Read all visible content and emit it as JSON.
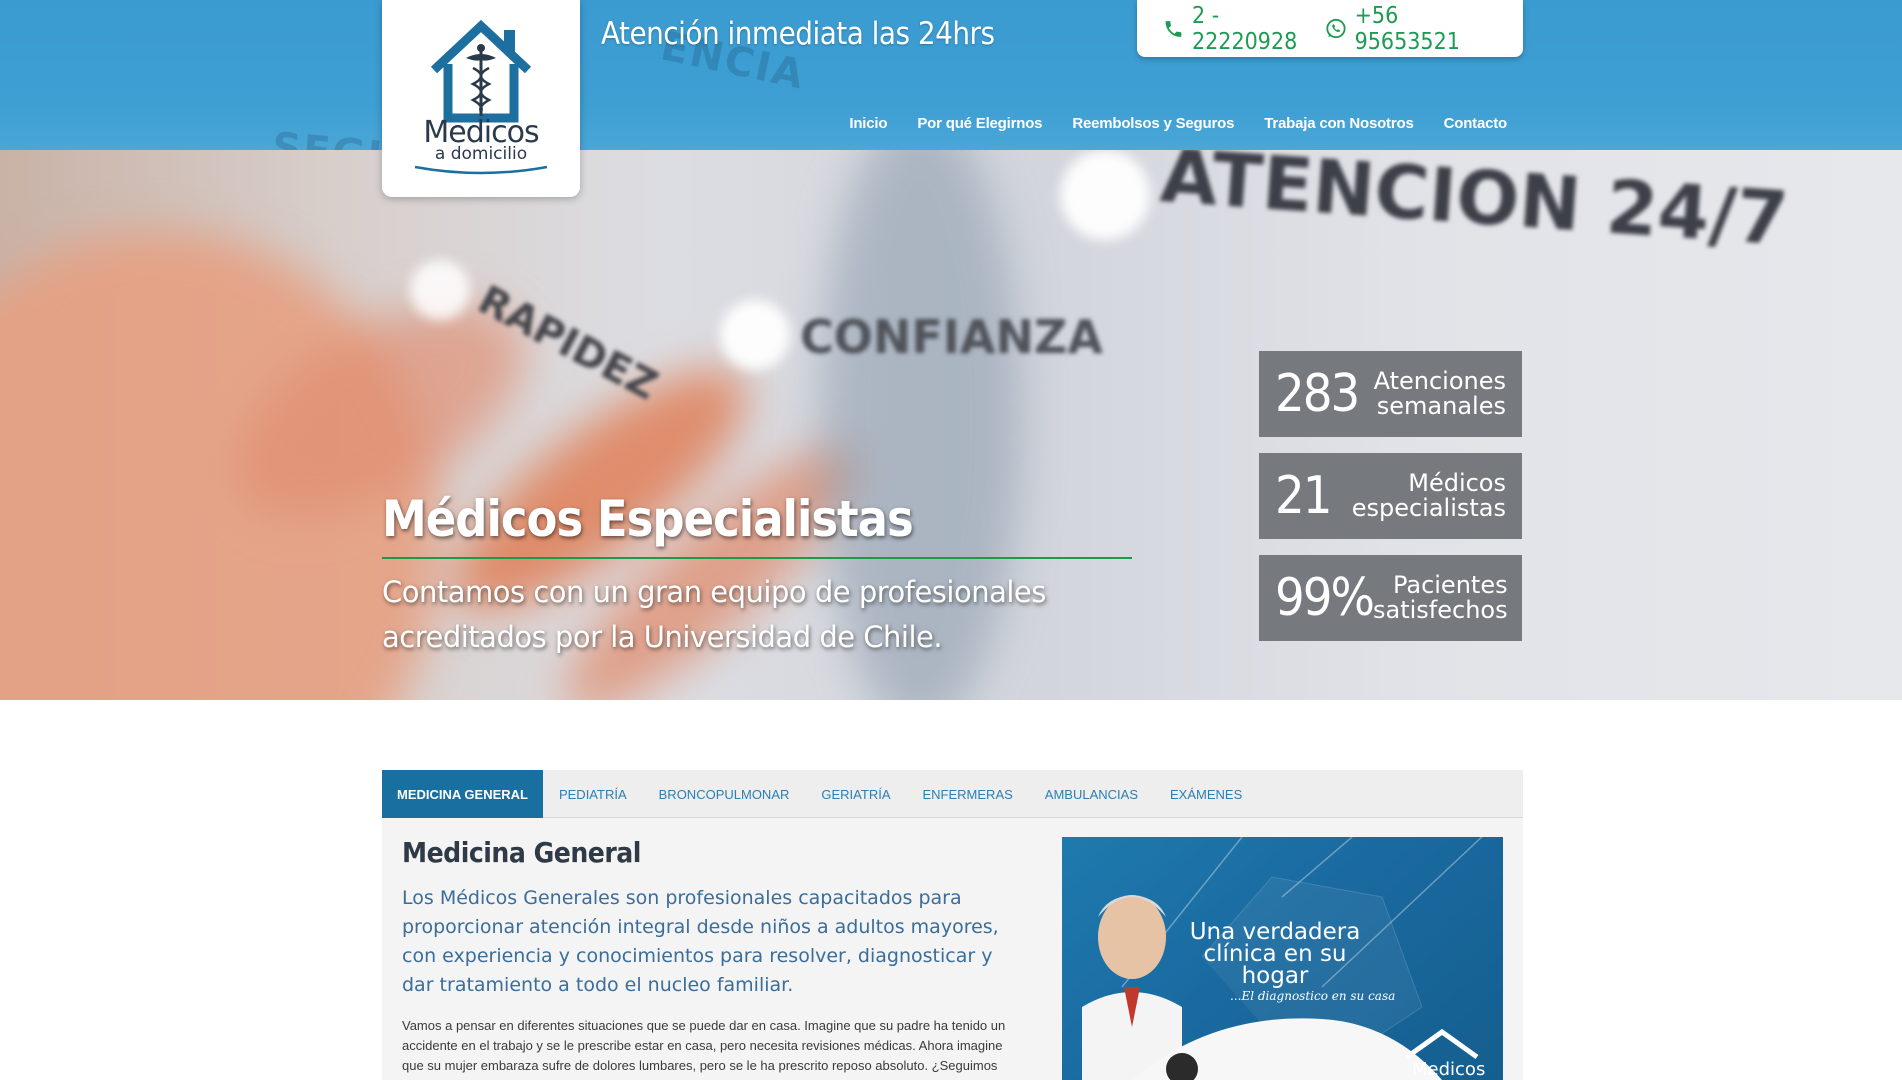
{
  "header": {
    "tagline": "Atención inmediata las 24hrs",
    "phone_label": "2 - 22220928",
    "whatsapp_label": "+56 95653521",
    "phone_icon": "phone-icon",
    "whatsapp_icon": "whatsapp-icon"
  },
  "logo": {
    "main": "Medicos",
    "sub": "a domicilio"
  },
  "nav": {
    "items": [
      {
        "label": "Inicio",
        "active": true
      },
      {
        "label": "Por qué Elegirnos"
      },
      {
        "label": "Reembolsos y Seguros"
      },
      {
        "label": "Trabaja con Nosotros"
      },
      {
        "label": "Contacto"
      }
    ]
  },
  "hero": {
    "title": "Médicos Especialistas",
    "subtitle": "Contamos con un gran equipo de profesionales acreditados por la Universidad de Chile.",
    "background_words": [
      "ATENCION 24/7",
      "CONFIANZA",
      "RAPIDEZ",
      "SEGU",
      "ENCIA"
    ]
  },
  "stats": [
    {
      "value": "283",
      "label_1": "Atenciones",
      "label_2": "semanales"
    },
    {
      "value": "21",
      "label_1": "Médicos",
      "label_2": "especialistas"
    },
    {
      "value": "99%",
      "label_1": "Pacientes",
      "label_2": "satisfechos"
    }
  ],
  "tabs": [
    {
      "label": "MEDICINA GENERAL",
      "active": true
    },
    {
      "label": "PEDIATRÍA"
    },
    {
      "label": "BRONCOPULMONAR"
    },
    {
      "label": "GERIATRÍA"
    },
    {
      "label": "ENFERMERAS"
    },
    {
      "label": "AMBULANCIAS"
    },
    {
      "label": "EXÁMENES"
    }
  ],
  "panel": {
    "title": "Medicina General",
    "lead": "Los Médicos Generales son profesionales capacitados para proporcionar atención integral desde niños a adultos mayores, con experiencia y conocimientos para resolver, diagnosticar y dar tratamiento a todo el nucleo familiar.",
    "body": "Vamos a pensar en diferentes situaciones que se puede dar en casa. Imagine que su padre ha tenido un accidente en el trabajo y se le prescribe estar en casa, pero necesita revisiones médicas. Ahora imagine que su mujer embaraza sufre de dolores lumbares, pero se le ha prescrito reposo absoluto. ¿Seguimos"
  },
  "promo": {
    "title": "Una verdadera clínica en su hogar",
    "subtitle": "...El diagnostico en su casa",
    "brand": "Medicos"
  },
  "colors": {
    "header_blue": "#3a9bd1",
    "nav_active_tab": "#1a6fa1",
    "accent_green": "#1d9b53",
    "stat_box": "#767a7e",
    "tab_link": "#2a7fb5"
  }
}
